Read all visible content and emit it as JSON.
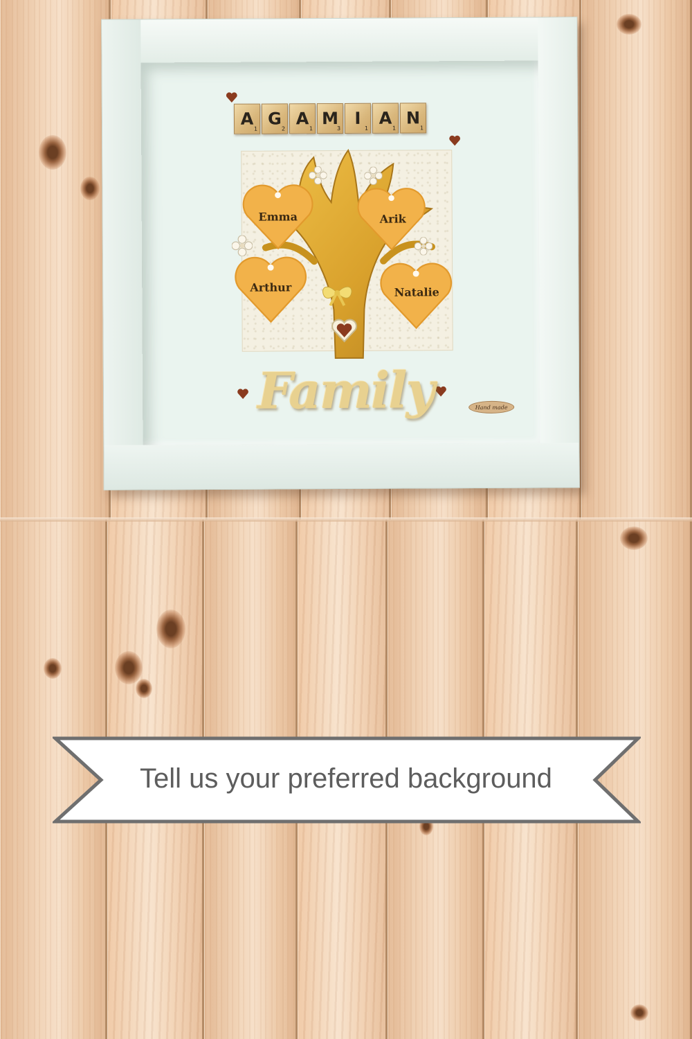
{
  "frame": {
    "surname_tiles": [
      {
        "letter": "A",
        "score": "1"
      },
      {
        "letter": "G",
        "score": "2"
      },
      {
        "letter": "A",
        "score": "1"
      },
      {
        "letter": "M",
        "score": "3"
      },
      {
        "letter": "I",
        "score": "1"
      },
      {
        "letter": "A",
        "score": "1"
      },
      {
        "letter": "N",
        "score": "1"
      }
    ],
    "hearts": [
      "Emma",
      "Arik",
      "Arthur",
      "Natalie"
    ],
    "family_word": "Family",
    "handmade_tag": "Hand made"
  },
  "banner": {
    "text": "Tell us your preferred background"
  },
  "colors": {
    "wood": "#e8c9a8",
    "frame": "#e6f0ea",
    "heart": "#f2b24a",
    "banner_border": "#6f6f6f",
    "banner_text": "#5d5d5d"
  }
}
